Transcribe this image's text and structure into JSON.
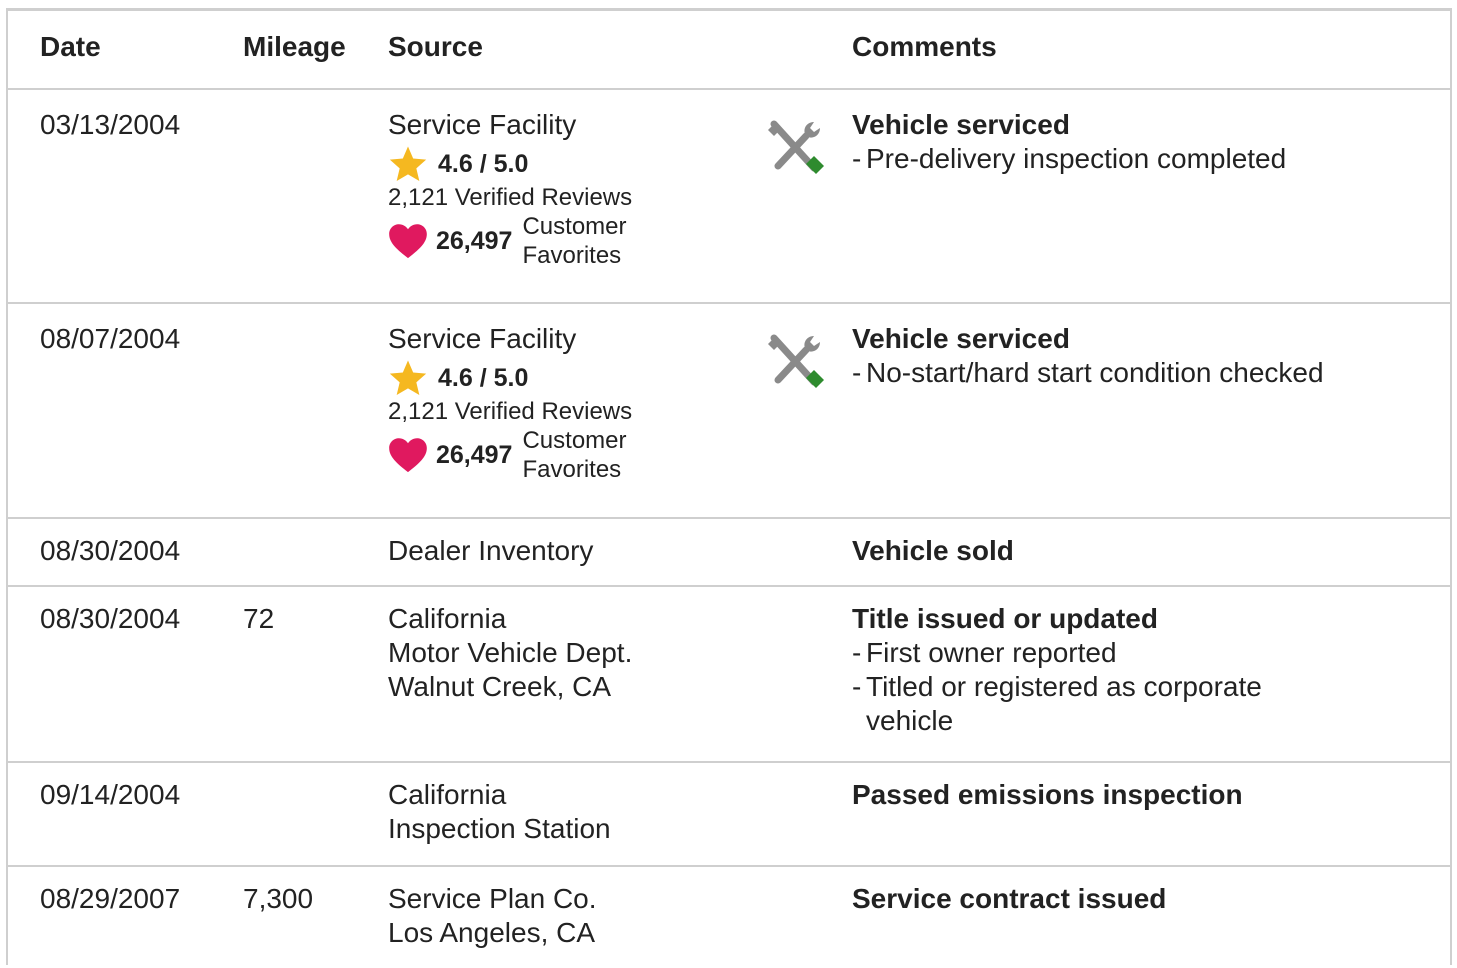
{
  "headers": {
    "date": "Date",
    "mileage": "Mileage",
    "source": "Source",
    "comments": "Comments"
  },
  "rows": [
    {
      "date": "03/13/2004",
      "mileage": "",
      "source_name": "Service Facility",
      "rating": "4.6 / 5.0",
      "reviews": "2,121 Verified Reviews",
      "favorites_count": "26,497",
      "favorites_label_1": "Customer",
      "favorites_label_2": "Favorites",
      "icon": "service-tools-icon",
      "comment_title": "Vehicle serviced",
      "comment_details": [
        "Pre-delivery inspection completed"
      ]
    },
    {
      "date": "08/07/2004",
      "mileage": "",
      "source_name": "Service Facility",
      "rating": "4.6 / 5.0",
      "reviews": "2,121 Verified Reviews",
      "favorites_count": "26,497",
      "favorites_label_1": "Customer",
      "favorites_label_2": "Favorites",
      "icon": "service-tools-icon",
      "comment_title": "Vehicle serviced",
      "comment_details": [
        "No-start/hard start condition checked"
      ]
    },
    {
      "date": "08/30/2004",
      "mileage": "",
      "source_lines": [
        "Dealer Inventory"
      ],
      "comment_title": "Vehicle sold",
      "comment_details": []
    },
    {
      "date": "08/30/2004",
      "mileage": "72",
      "source_lines": [
        "California",
        "Motor Vehicle Dept.",
        "Walnut Creek, CA"
      ],
      "comment_title": "Title issued or updated",
      "comment_details": [
        "First owner reported",
        "Titled or registered as corporate",
        "vehicle"
      ]
    },
    {
      "date": "09/14/2004",
      "mileage": "",
      "source_lines": [
        "California",
        "Inspection Station"
      ],
      "comment_title": "Passed emissions inspection",
      "comment_details": []
    },
    {
      "date": "08/29/2007",
      "mileage": "7,300",
      "source_lines": [
        "Service Plan Co.",
        "Los Angeles, CA"
      ],
      "comment_title": "Service contract issued",
      "comment_details": []
    }
  ],
  "colors": {
    "star": "#f5b820",
    "heart": "#e0195f",
    "wrench_gray": "#8a8a8a",
    "screwdriver_green": "#2e8b2e",
    "border": "#cfcfcf"
  }
}
